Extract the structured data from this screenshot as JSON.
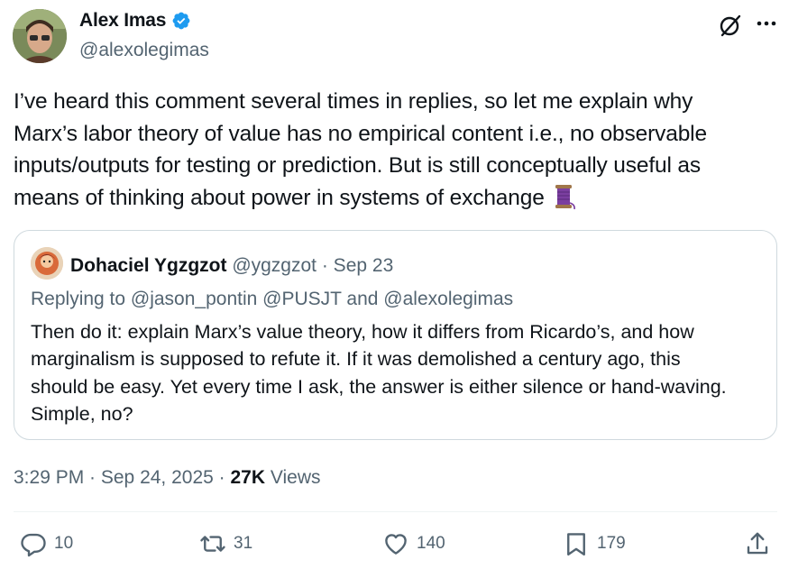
{
  "author": {
    "name": "Alex Imas",
    "handle": "@alexolegimas",
    "verified_color": "#1d9bf0"
  },
  "tweet": {
    "text": "I’ve heard this comment several times in replies, so let me explain why\nMarx’s labor theory of value has no empirical content i.e., no observable\ninputs/outputs for testing or prediction. But is still conceptually useful as\nmeans of thinking about power in systems of exchange ",
    "emoji": "spool-of-thread-icon"
  },
  "quote": {
    "name": "Dohaciel Ygzgzot",
    "handle": "@ygzgzot",
    "date": "· Sep 23",
    "replying_to": "Replying to @jason_pontin @PUSJT and @alexolegimas",
    "text": "Then do it: explain Marx’s value theory, how it differs from Ricardo’s, and how\nmarginalism is supposed to refute it. If it was demolished a century ago, this\nshould be easy. Yet every time I ask, the answer is either silence or hand-waving.\nSimple, no?"
  },
  "meta": {
    "time": "3:29 PM · Sep 24, 2025 · ",
    "views_count": "27K",
    "views_label": " Views"
  },
  "actions": {
    "replies": "10",
    "reposts": "31",
    "likes": "140",
    "bookmarks": "179"
  },
  "icons": {
    "top": [
      "grok-icon",
      "more-icon"
    ],
    "actions": [
      "reply-icon",
      "repost-icon",
      "like-icon",
      "bookmark-icon",
      "share-icon"
    ]
  }
}
